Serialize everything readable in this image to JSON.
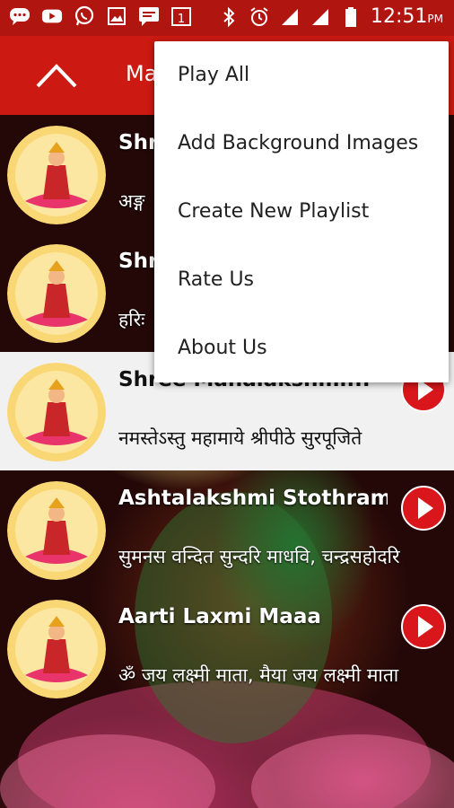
{
  "status_bar": {
    "time": "12:51",
    "ampm": "PM",
    "notification_icons": [
      "message-icon",
      "youtube-icon",
      "whatsapp-icon",
      "gallery-icon",
      "sms-icon",
      "calendar-icon"
    ],
    "calendar_day": "1",
    "system_icons": [
      "bluetooth-icon",
      "alarm-icon",
      "signal-icon",
      "signal-icon",
      "battery-icon"
    ]
  },
  "app_bar": {
    "title": "Ma",
    "color": "#cc1a12"
  },
  "menu": {
    "items": [
      "Play All",
      "Add Background Images",
      "Create New Playlist",
      "Rate Us",
      "About Us"
    ]
  },
  "list": {
    "items": [
      {
        "title": "Shr",
        "subtitle": "अङ्ग",
        "selected": false
      },
      {
        "title": "Shr",
        "subtitle": "हरिः",
        "selected": false
      },
      {
        "title": "Shree Mahalakshmi...",
        "subtitle": "नमस्तेऽस्तु महामाये श्रीपीठे सुरपूजिते",
        "selected": true
      },
      {
        "title": "Ashtalakshmi Stothram",
        "subtitle": "सुमनस वन्दित सुन्दरि माधवि, चन्द्रसहोदरि",
        "selected": false
      },
      {
        "title": "Aarti Laxmi Maaa",
        "subtitle": "ॐ जय लक्ष्मी माता, मैया जय लक्ष्मी माता",
        "selected": false
      }
    ]
  },
  "colors": {
    "status_bar": "#b11510",
    "accent_play": "#d8161b",
    "selected_row": "#f1f1f1"
  }
}
